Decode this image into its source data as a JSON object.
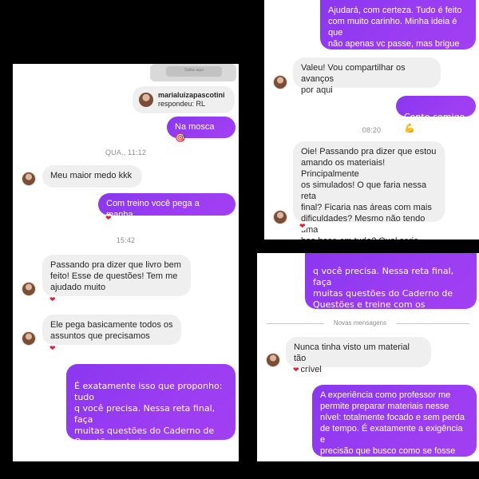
{
  "left": {
    "preview_button": "Saiba aqui",
    "reply": {
      "username": "marialuizapascotini",
      "label": "respondeu: RL"
    },
    "msg_na_mosca": "Na mosca 🎯",
    "ts_1": "QUA., 11:12",
    "msg_maior_medo": "Meu maior medo kkk",
    "msg_com_treino": "Com treino você pega a manha",
    "ts_2": "15:42",
    "msg_passando": "Passando pra dizer que livro bem\nfeito! Esse de questões! Tem me\najudado muito",
    "msg_ele_pega": "Ele pega basicamente todos os\nassuntos que precisamos",
    "msg_exatamente": "É exatamente isso que proponho: tudo\nq você precisa. Nessa reta final, faça\nmuitas questões do Caderno de\nQuestões e treine com os Simulados.\nVocê terá zero surpresas na hora da\nprova. Teu crachá já te espera 😍 🙏"
  },
  "top_right": {
    "msg_ajudara": "Ajudará, com certeza. Tudo é feito\ncom muito carinho. Minha ideia é que\nnão apenas vc passe, mas brigue\npelas primeiras colocações",
    "msg_valeu": "Valeu! Vou compartilhar os avanços\npor aqui",
    "msg_conte": "Conte comigo 💪",
    "ts": "08:20",
    "msg_oie": "Oie! Passando pra dizer que estou\namando os materiais! Principalmente\nos simulados! O que faria nessa reta\nfinal? Ficaria nas áreas com mais\ndificuldades? Mesmo não tendo uma\nboa base em tudo? Qual seria uma\nboa estratégia?"
  },
  "bottom_right": {
    "msg_cont": "q você precisa. Nessa reta final, faça\nmuitas questões do Caderno de\nQuestões e treine com os Simulados.\nVocê terá zero surpresas na hora da\nprova. Teu crachá já te espera 😍 🙏",
    "divider": "Novas mensagens",
    "msg_nunca": "Nunca tinha visto um material tão\nincrível",
    "msg_experiencia": "A experiência como professor me\npermite preparar materiais nesse\nnível: totalmente focado e sem perda\nde tempo. É exatamente a exigência e\nprecisão que busco como se fosse\npara mim"
  },
  "reaction": "❤"
}
